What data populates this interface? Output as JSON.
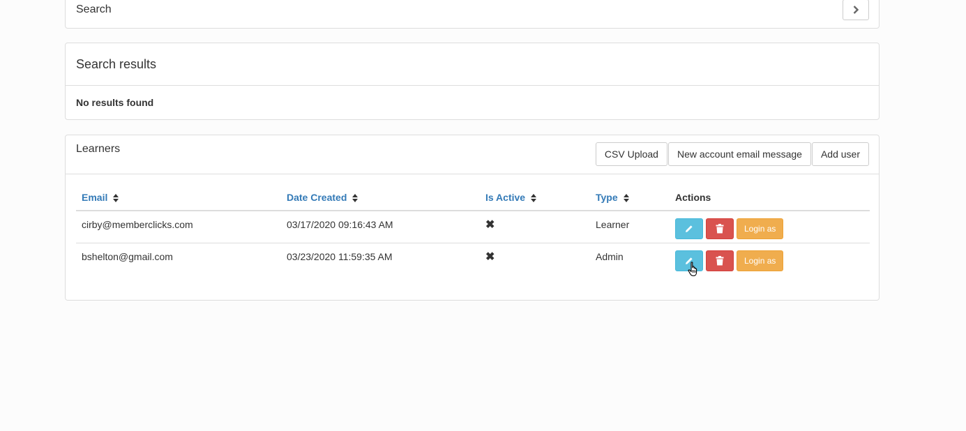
{
  "search_panel": {
    "title": "Search",
    "expand_icon": "chevron-right-icon"
  },
  "results_panel": {
    "title": "Search results",
    "message": "No results found"
  },
  "learners_panel": {
    "title": "Learners",
    "buttons": {
      "csv_upload": "CSV Upload",
      "email_message": "New account email message",
      "add_user": "Add user"
    },
    "columns": {
      "email": "Email",
      "date_created": "Date Created",
      "is_active": "Is Active",
      "type": "Type",
      "actions": "Actions"
    },
    "rows": [
      {
        "email": "cirby@memberclicks.com",
        "date_created": "03/17/2020 09:16:43 AM",
        "is_active": "✖",
        "type": "Learner",
        "login_label": "Login as"
      },
      {
        "email": "bshelton@gmail.com",
        "date_created": "03/23/2020 11:59:35 AM",
        "is_active": "✖",
        "type": "Admin",
        "login_label": "Login as"
      }
    ]
  },
  "colors": {
    "link": "#337ab7",
    "info": "#5bc0de",
    "danger": "#d9534f",
    "warning": "#f0ad4e"
  }
}
